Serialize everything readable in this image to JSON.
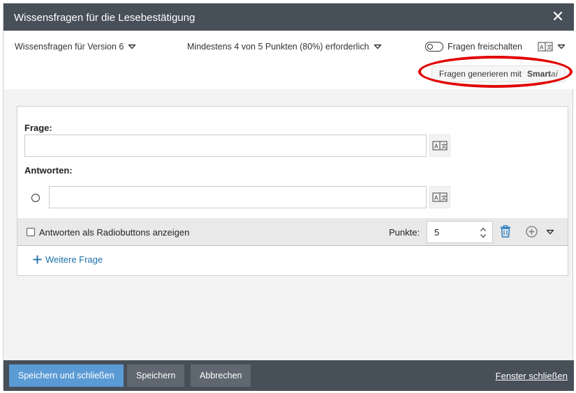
{
  "dialog": {
    "title": "Wissensfragen für die Lesebestätigung"
  },
  "toolbar": {
    "version_label": "Wissensfragen für Version 6",
    "threshold_label": "Mindestens 4 von 5 Punkten (80%) erforderlich",
    "toggle_label": "Fragen freischalten",
    "toggle_on": false,
    "generate_label": "Fragen generieren mit",
    "brand_main": "Smart",
    "brand_suffix": "ai"
  },
  "question": {
    "question_label": "Frage:",
    "question_value": "",
    "answers_label": "Antworten:",
    "answer_value": "",
    "radio_option_label": "Antworten als Radiobuttons anzeigen",
    "points_label": "Punkte:",
    "points_value": "5"
  },
  "add_question_label": "Weitere Frage",
  "footer": {
    "save_close": "Speichern und schließen",
    "save": "Speichern",
    "cancel": "Abbrechen",
    "close_window": "Fenster schließen"
  },
  "colors": {
    "titlebar": "#474f58",
    "primary_button": "#5b9bd5",
    "link": "#1b6fa8",
    "highlight": "#e10000"
  }
}
